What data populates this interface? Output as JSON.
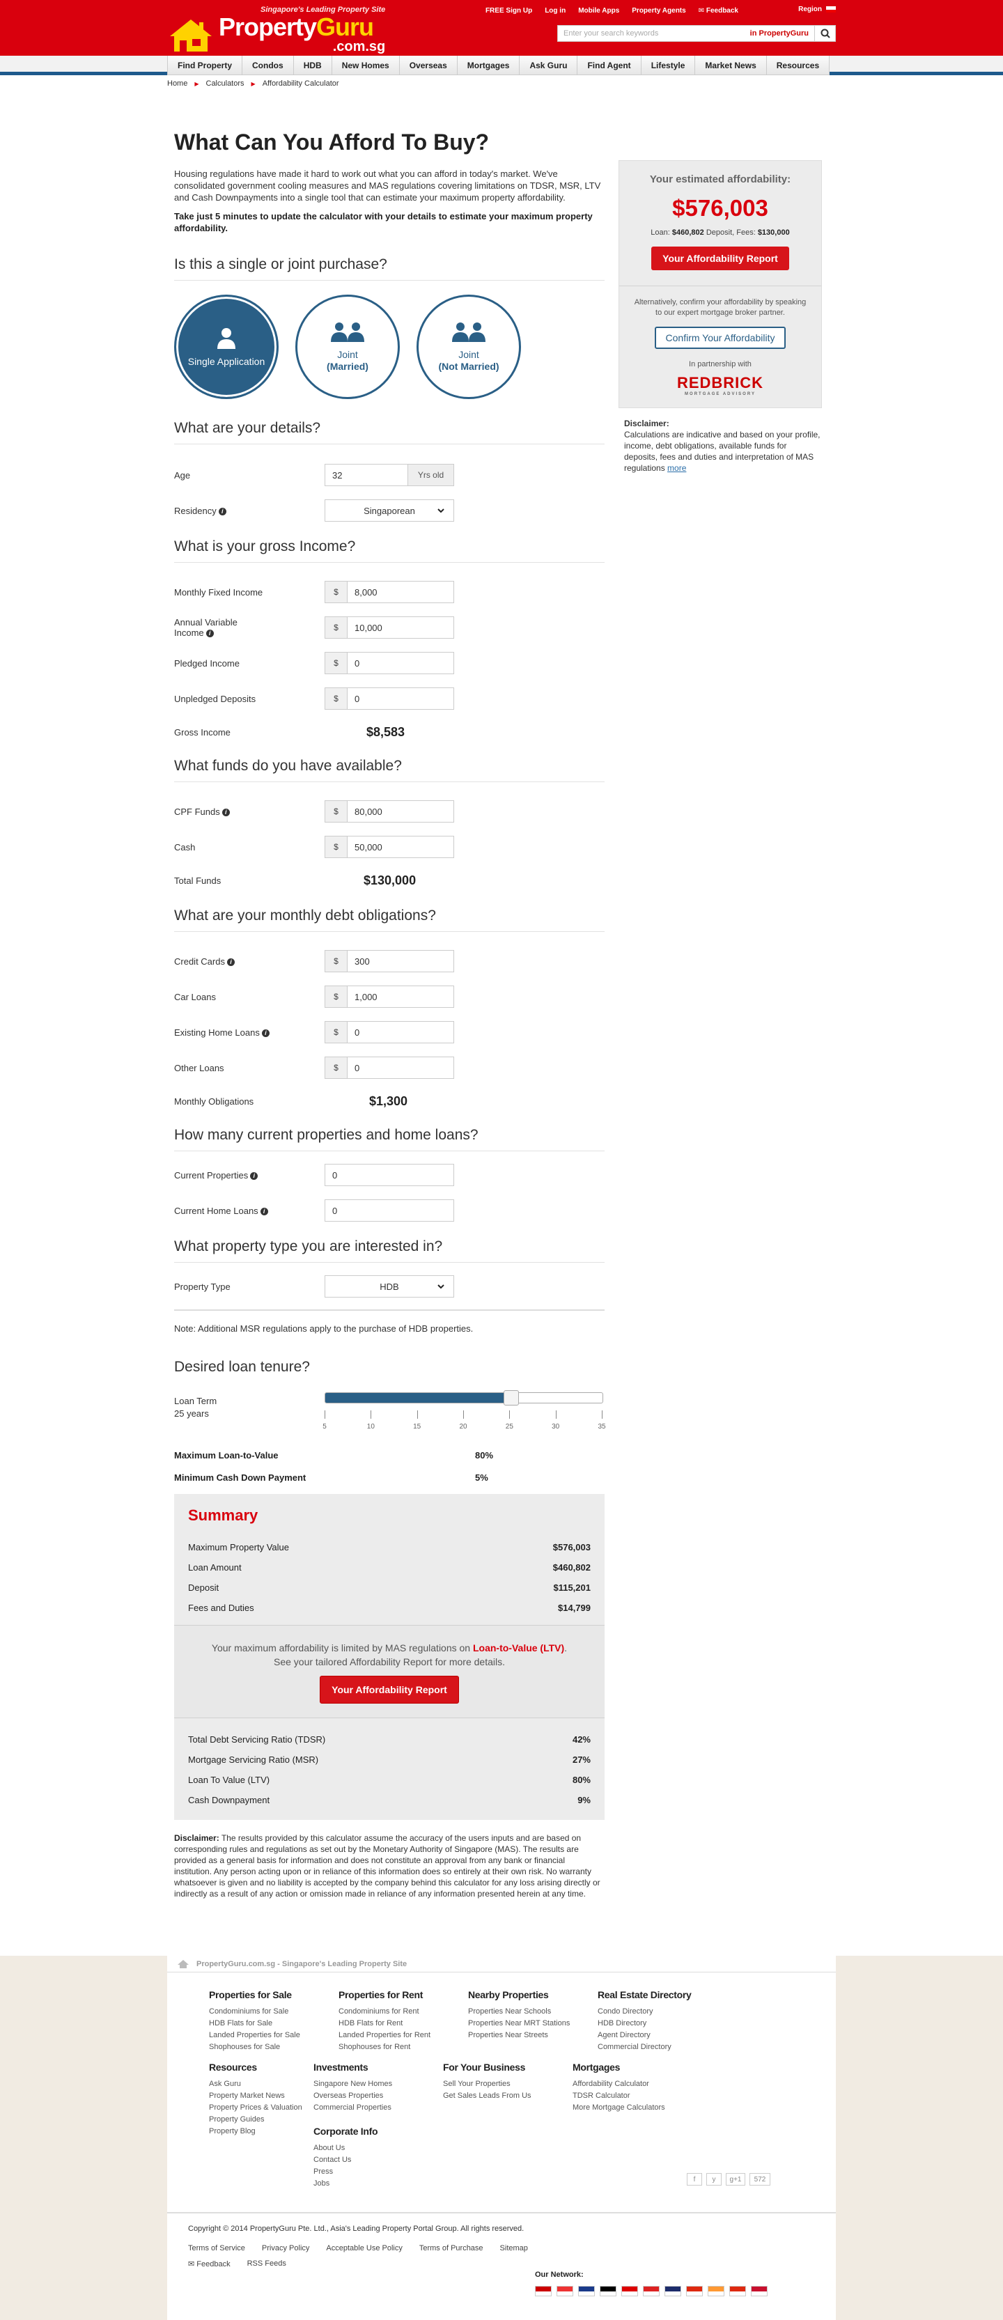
{
  "header": {
    "tagline": "Singapore's Leading Property Site",
    "brand_property": "Property",
    "brand_guru": "Guru",
    "brand_domain": ".com.sg",
    "toplinks": [
      "FREE Sign Up",
      "Log in",
      "Mobile Apps",
      "Property Agents",
      "Feedback"
    ],
    "region": "Region",
    "search_placeholder": "Enter your search keywords",
    "search_scope": "in PropertyGuru"
  },
  "nav": [
    "Find Property",
    "Condos",
    "HDB",
    "New Homes",
    "Overseas",
    "Mortgages",
    "Ask Guru",
    "Find Agent",
    "Lifestyle",
    "Market News",
    "Resources"
  ],
  "breadcrumb": [
    "Home",
    "Calculators",
    "Affordability Calculator"
  ],
  "page": {
    "title": "What Can You Afford To Buy?",
    "intro": "Housing regulations have made it hard to work out what you can afford in today's market. We've consolidated government cooling measures and MAS regulations covering limitations on TDSR, MSR, LTV and Cash Downpayments into a single tool that can estimate your maximum property affordability.",
    "intro_bold": "Take just 5 minutes to update the calculator with your details to estimate your maximum property affordability."
  },
  "purchase": {
    "title": "Is this a single or joint purchase?",
    "options": [
      {
        "line1": "Single Application",
        "line2": ""
      },
      {
        "line1": "Joint",
        "line2": "(Married)"
      },
      {
        "line1": "Joint",
        "line2": "(Not Married)"
      }
    ]
  },
  "details": {
    "title": "What are your details?",
    "age_label": "Age",
    "age_value": "32",
    "age_unit": "Yrs old",
    "residency_label": "Residency",
    "residency_value": "Singaporean"
  },
  "income": {
    "title": "What is your gross Income?",
    "currency": "$",
    "monthly_fixed_label": "Monthly Fixed Income",
    "monthly_fixed": "8,000",
    "annual_variable_label": "Annual Variable Income",
    "annual_variable": "10,000",
    "pledged_label": "Pledged Income",
    "pledged": "0",
    "unpledged_label": "Unpledged Deposits",
    "unpledged": "0",
    "gross_label": "Gross Income",
    "gross": "$8,583"
  },
  "funds": {
    "title": "What funds do you have available?",
    "cpf_label": "CPF Funds",
    "cpf": "80,000",
    "cash_label": "Cash",
    "cash": "50,000",
    "total_label": "Total Funds",
    "total": "$130,000"
  },
  "debt": {
    "title": "What are your monthly debt obligations?",
    "credit_label": "Credit Cards",
    "credit": "300",
    "car_label": "Car Loans",
    "car": "1,000",
    "home_label": "Existing Home Loans",
    "home": "0",
    "other_label": "Other Loans",
    "other": "0",
    "total_label": "Monthly Obligations",
    "total": "$1,300"
  },
  "current": {
    "title": "How many current properties and home loans?",
    "props_label": "Current Properties",
    "props": "0",
    "loans_label": "Current Home Loans",
    "loans": "0"
  },
  "ptype": {
    "title": "What property type you are interested in?",
    "label": "Property Type",
    "value": "HDB",
    "note": "Note: Additional MSR regulations apply to the purchase of HDB properties."
  },
  "tenure": {
    "title": "Desired loan tenure?",
    "label": "Loan Term",
    "value_text": "25 years",
    "min": 5,
    "max": 35,
    "value": 25,
    "ticks": [
      "5",
      "10",
      "15",
      "20",
      "25",
      "30",
      "35"
    ],
    "ltv_label": "Maximum Loan-to-Value",
    "ltv": "80%",
    "cash_label": "Minimum Cash Down Payment",
    "cash": "5%"
  },
  "summary": {
    "title": "Summary",
    "rows": [
      {
        "k": "Maximum Property Value",
        "v": "$576,003"
      },
      {
        "k": "Loan Amount",
        "v": "$460,802"
      },
      {
        "k": "Deposit",
        "v": "$115,201"
      },
      {
        "k": "Fees and Duties",
        "v": "$14,799"
      }
    ],
    "msg_pre": "Your maximum affordability is limited by MAS regulations on ",
    "msg_ltv": "Loan-to-Value (LTV)",
    "msg_post": ". See your tailored Affordability Report for more details.",
    "button": "Your Affordability Report",
    "ratios": [
      {
        "k": "Total Debt Servicing Ratio (TDSR)",
        "v": "42%"
      },
      {
        "k": "Mortgage Servicing Ratio (MSR)",
        "v": "27%"
      },
      {
        "k": "Loan To Value (LTV)",
        "v": "80%"
      },
      {
        "k": "Cash Downpayment",
        "v": "9%"
      }
    ]
  },
  "disclaimer_bottom": {
    "label": "Disclaimer:",
    "text": " The results provided by this calculator assume the accuracy of the users inputs and are based on corresponding rules and regulations as set out by the Monetary Authority of Singapore (MAS). The results are provided as a general basis for information and does not constitute an approval from any bank or financial institution. Any person acting upon or in reliance of this information does so entirely at their own risk. No warranty whatsoever is given and no liability is accepted by the company behind this calculator for any loss arising directly or indirectly as a result of any action or omission made in reliance of any information presented herein at any time."
  },
  "sidebar": {
    "title": "Your estimated affordability:",
    "amount": "$576,003",
    "loan_label": "Loan:",
    "loan": "$460,802",
    "deposit_label": "Deposit, Fees:",
    "fees": "$130,000",
    "report_button": "Your Affordability Report",
    "alt_text": "Alternatively, confirm your affordability by speaking to our expert mortgage broker partner.",
    "confirm_button": "Confirm Your Affordability",
    "partner": "In partnership with",
    "partner_name": "REDBRICK",
    "partner_sub": "MORTGAGE ADVISORY",
    "disc_label": "Disclaimer:",
    "disc_text": "Calculations are indicative and based on your profile, income, debt obligations, available funds for deposits, fees and duties and interpretation of MAS regulations ",
    "more": "more"
  },
  "footer": {
    "site": "PropertyGuru.com.sg - Singapore's Leading Property Site",
    "cols": [
      {
        "title": "Properties for Sale",
        "links": [
          "Condominiums for Sale",
          "HDB Flats for Sale",
          "Landed Properties for Sale",
          "Shophouses for Sale"
        ]
      },
      {
        "title": "Properties for Rent",
        "links": [
          "Condominiums for Rent",
          "HDB Flats for Rent",
          "Landed Properties for Rent",
          "Shophouses for Rent"
        ]
      },
      {
        "title": "Nearby Properties",
        "links": [
          "Properties Near Schools",
          "Properties Near MRT Stations",
          "Properties Near Streets"
        ]
      },
      {
        "title": "Real Estate Directory",
        "links": [
          "Condo Directory",
          "HDB Directory",
          "Agent Directory",
          "Commercial Directory"
        ]
      },
      {
        "title": "Resources",
        "links": [
          "Ask Guru",
          "Property Market News",
          "Property Prices & Valuation",
          "Property Guides",
          "Property Blog"
        ]
      },
      {
        "title": "Investments",
        "links": [
          "Singapore New Homes",
          "Overseas Properties",
          "Commercial Properties"
        ]
      },
      {
        "title": "For Your Business",
        "links": [
          "Sell Your Properties",
          "Get Sales Leads From Us"
        ]
      },
      {
        "title": "Mortgages",
        "links": [
          "Affordability Calculator",
          "TDSR Calculator",
          "More Mortgage Calculators"
        ]
      },
      {
        "title": "Corporate Info",
        "links": [
          "About Us",
          "Contact Us",
          "Press",
          "Jobs"
        ]
      }
    ],
    "social": [
      "f",
      "y",
      "g+1",
      "572"
    ],
    "copyright": "Copyright © 2014 PropertyGuru Pte. Ltd., Asia's Leading Property Portal Group. All rights reserved.",
    "links": [
      "Terms of Service",
      "Privacy Policy",
      "Acceptable Use Policy",
      "Terms of Purchase",
      "Sitemap"
    ],
    "links2": [
      "Feedback",
      "RSS Feeds"
    ],
    "network": "Our Network:",
    "colors": {
      "flags": [
        "#cc0000",
        "#ee3333",
        "#1a3a8a",
        "#000000",
        "#dd0000",
        "#dd2222",
        "#1d2c6b",
        "#de2910",
        "#ff9933",
        "#de2910",
        "#c8102e"
      ]
    }
  },
  "colors": {
    "brand_red": "#d9000d",
    "brand_blue": "#2a5f86",
    "guru_yellow": "#ffd200"
  }
}
